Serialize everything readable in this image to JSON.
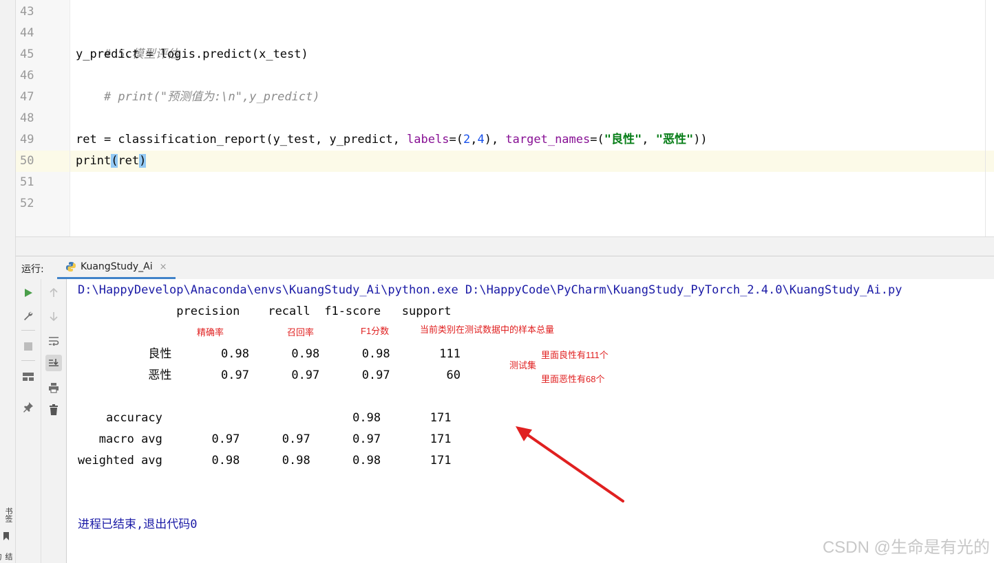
{
  "sidebar": {
    "bookmarks_label": "书签",
    "structure_label": "结构"
  },
  "editor": {
    "line_numbers": [
      "43",
      "44",
      "45",
      "46",
      "47",
      "48",
      "49",
      "50",
      "51",
      "52"
    ],
    "lines": {
      "l44_comment": "# 5.模型评估",
      "l45": "y_predict = logis.predict(x_test)",
      "l46_comment": "# print(\"预测值为:\\n\",y_predict)",
      "l49_a": "ret = classification_report(y_test, y_predict, ",
      "l49_labels_kw": "labels",
      "l49_b": "=(",
      "l49_num2": "2",
      "l49_c": ",",
      "l49_num4": "4",
      "l49_d": "), ",
      "l49_target_kw": "target_names",
      "l49_e": "=(",
      "l49_str1": "\"良性\"",
      "l49_f": ", ",
      "l49_str2": "\"恶性\"",
      "l49_g": "))",
      "l50_a": "print",
      "l50_paren_open": "(",
      "l50_b": "ret",
      "l50_paren_close": ")"
    }
  },
  "run_panel": {
    "label": "运行:",
    "tab_name": "KuangStudy_Ai",
    "close_glyph": "×"
  },
  "console": {
    "command": "D:\\HappyDevelop\\Anaconda\\envs\\KuangStudy_Ai\\python.exe D:\\HappyCode\\PyCharm\\KuangStudy_PyTorch_2.4.0\\KuangStudy_Ai.py",
    "header": "              precision    recall  f1-score   support",
    "row_benign": "          良性       0.98      0.98      0.98       111",
    "row_malignant": "          恶性       0.97      0.97      0.97        60",
    "row_accuracy": "    accuracy                           0.98       171",
    "row_macro": "   macro avg       0.97      0.97      0.97       171",
    "row_weighted": "weighted avg       0.98      0.98      0.98       171",
    "exit_message": "进程已结束,退出代码0"
  },
  "annotations": {
    "precision_cn": "精确率",
    "recall_cn": "召回率",
    "f1_cn": "F1分数",
    "support_cn": "当前类别在测试数据中的样本总量",
    "test_set": "测试集",
    "benign_count": "里面良性有111个",
    "malignant_count": "里面恶性有68个",
    "arrow_color": "#e02020"
  },
  "watermark": "CSDN @生命是有光的"
}
